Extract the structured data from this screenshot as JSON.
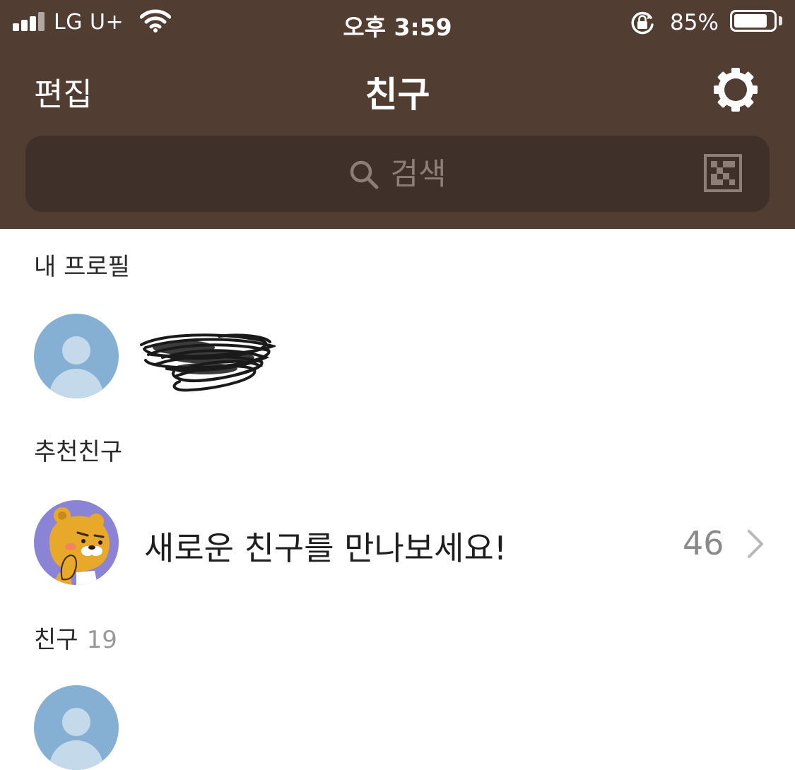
{
  "status_bar": {
    "carrier": "LG U+",
    "time": "오후 3:59",
    "battery_percent": "85%",
    "battery_level": 0.85,
    "icons": [
      "signal-icon",
      "wifi-icon",
      "rotation-lock-icon",
      "battery-icon"
    ]
  },
  "nav": {
    "edit_label": "편집",
    "title": "친구",
    "settings_icon": "gear-icon"
  },
  "search": {
    "placeholder": "검색",
    "icons": [
      "search-icon",
      "qr-code-icon"
    ]
  },
  "my_profile": {
    "section_label": "내 프로필"
  },
  "recommended": {
    "section_label": "추천친구",
    "row_text": "새로운 친구를 만나보세요!",
    "count": "46"
  },
  "friends": {
    "section_label": "친구",
    "count": "19"
  },
  "colors": {
    "header_bg": "#523d33",
    "search_bg": "#40302a",
    "avatar_default": "#86b0d3",
    "avatar_ryan": "#8b84d6"
  }
}
